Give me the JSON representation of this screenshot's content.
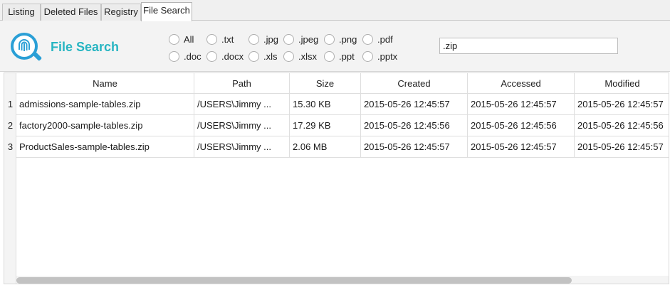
{
  "tabs": [
    {
      "label": "Listing",
      "active": false
    },
    {
      "label": "Deleted Files",
      "active": false
    },
    {
      "label": "Registry",
      "active": false
    },
    {
      "label": "File Search",
      "active": true
    }
  ],
  "header": {
    "title": "File Search",
    "logo_icon": "fingerprint-magnifier-icon",
    "accent_color": "#28b5c2"
  },
  "filters": [
    {
      "label": "All",
      "checked": false
    },
    {
      "label": ".txt",
      "checked": false
    },
    {
      "label": ".jpg",
      "checked": false
    },
    {
      "label": ".jpeg",
      "checked": false
    },
    {
      "label": ".png",
      "checked": false
    },
    {
      "label": ".pdf",
      "checked": false
    },
    {
      "label": ".doc",
      "checked": false
    },
    {
      "label": ".docx",
      "checked": false
    },
    {
      "label": ".xls",
      "checked": false
    },
    {
      "label": ".xlsx",
      "checked": false
    },
    {
      "label": ".ppt",
      "checked": false
    },
    {
      "label": ".pptx",
      "checked": false
    }
  ],
  "search": {
    "value": ".zip"
  },
  "table": {
    "columns": [
      "Name",
      "Path",
      "Size",
      "Created",
      "Accessed",
      "Modified"
    ],
    "rows": [
      {
        "num": "1",
        "cells": [
          "admissions-sample-tables.zip",
          "/USERS\\Jimmy ...",
          "15.30 KB",
          "2015-05-26 12:45:57",
          "2015-05-26 12:45:57",
          "2015-05-26 12:45:57"
        ]
      },
      {
        "num": "2",
        "cells": [
          "factory2000-sample-tables.zip",
          "/USERS\\Jimmy ...",
          "17.29 KB",
          "2015-05-26 12:45:56",
          "2015-05-26 12:45:56",
          "2015-05-26 12:45:56"
        ]
      },
      {
        "num": "3",
        "cells": [
          "ProductSales-sample-tables.zip",
          "/USERS\\Jimmy ...",
          "2.06 MB",
          "2015-05-26 12:45:57",
          "2015-05-26 12:45:57",
          "2015-05-26 12:45:57"
        ]
      }
    ]
  }
}
